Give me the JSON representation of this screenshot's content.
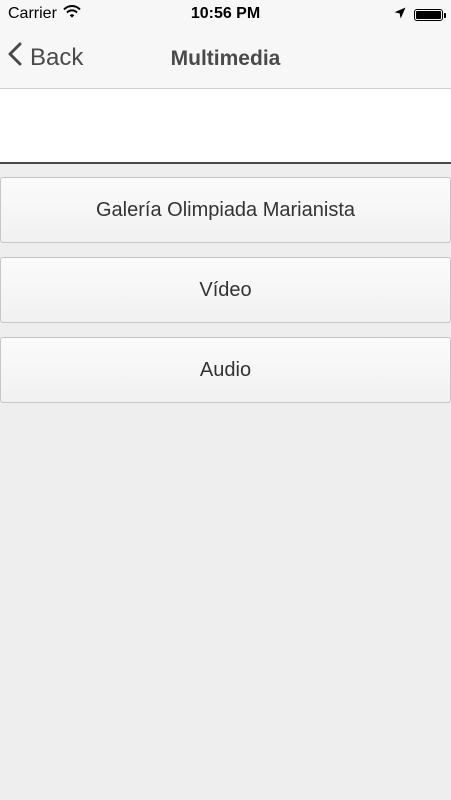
{
  "status_bar": {
    "carrier": "Carrier",
    "time": "10:56 PM",
    "battery_level": 1.0,
    "icons": [
      "wifi-icon",
      "location-arrow-icon",
      "battery-icon"
    ]
  },
  "nav": {
    "back_label": "Back",
    "title": "Multimedia",
    "back_icon": "chevron-left-icon"
  },
  "menu": {
    "items": [
      {
        "label": "Galería Olimpiada Marianista"
      },
      {
        "label": "Vídeo"
      },
      {
        "label": "Audio"
      }
    ]
  },
  "colors": {
    "background": "#eeeeee",
    "bar_background": "#f7f7f7",
    "nav_text": "#4a4a4a",
    "button_text": "#333333",
    "button_border": "#c6c6c6"
  }
}
